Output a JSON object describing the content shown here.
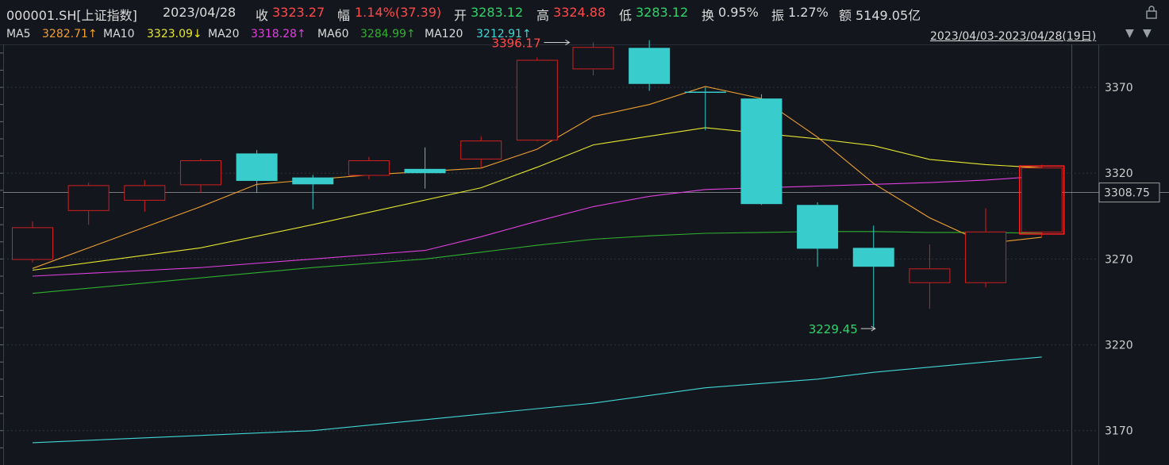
{
  "header": {
    "symbol": "000001.SH[上证指数]",
    "date": "2023/04/28",
    "close_label": "收",
    "close": "3323.27",
    "change_label": "幅",
    "change": "1.14%(37.39)",
    "open_label": "开",
    "open": "3283.12",
    "high_label": "高",
    "high": "3324.88",
    "low_label": "低",
    "low": "3283.12",
    "turnover_label": "换",
    "turnover": "0.95%",
    "amplitude_label": "振",
    "amplitude": "1.27%",
    "amount_label": "额",
    "amount": "5149.05亿"
  },
  "ma_bar": {
    "ma5_label": "MA5",
    "ma5": "3282.71↑",
    "ma10_label": "MA10",
    "ma10": "3323.09↓",
    "ma20_label": "MA20",
    "ma20": "3318.28↑",
    "ma60_label": "MA60",
    "ma60": "3284.99↑",
    "ma120_label": "MA120",
    "ma120": "3212.91↑",
    "range": "2023/04/03-2023/04/28(19日)",
    "dropdown_icon": "triangle-down-icon",
    "lock_icon": "lock-icon"
  },
  "colors": {
    "up": "#ff4a4a",
    "down": "#39cccc",
    "ma5": "#f0a030",
    "ma10": "#e8e830",
    "ma20": "#e040e0",
    "ma60": "#30b030",
    "ma120": "#40d8d8"
  },
  "chart_data": {
    "type": "candlestick",
    "ylim": [
      3150,
      3395
    ],
    "yticks": [
      3170,
      3220,
      3270,
      3320,
      3370
    ],
    "current_price_label": "3308.75",
    "current_price": 3308.75,
    "high_annotation": {
      "text": "3396.17",
      "value": 3396.17,
      "index": 10
    },
    "low_annotation": {
      "text": "3229.45",
      "value": 3229.45,
      "index": 15
    },
    "candles": [
      {
        "open": 3269.5,
        "close": 3288.5,
        "high": 3292.0,
        "low": 3268.0
      },
      {
        "open": 3298.0,
        "close": 3313.0,
        "high": 3314.5,
        "low": 3290.0
      },
      {
        "open": 3304.0,
        "close": 3313.0,
        "high": 3316.0,
        "low": 3297.5
      },
      {
        "open": 3313.0,
        "close": 3327.5,
        "high": 3328.5,
        "low": 3308.5
      },
      {
        "open": 3331.5,
        "close": 3315.5,
        "high": 3333.5,
        "low": 3308.5
      },
      {
        "open": 3317.5,
        "close": 3313.5,
        "high": 3319.0,
        "low": 3299.0
      },
      {
        "open": 3318.5,
        "close": 3327.5,
        "high": 3329.5,
        "low": 3316.5
      },
      {
        "open": 3322.5,
        "close": 3320.0,
        "high": 3335.0,
        "low": 3311.0
      },
      {
        "open": 3328.0,
        "close": 3339.0,
        "high": 3341.5,
        "low": 3323.0
      },
      {
        "open": 3339.0,
        "close": 3386.0,
        "high": 3387.5,
        "low": 3338.5
      },
      {
        "open": 3380.5,
        "close": 3393.5,
        "high": 3396.17,
        "low": 3377.0
      },
      {
        "open": 3393.0,
        "close": 3372.0,
        "high": 3397.5,
        "low": 3368.0
      },
      {
        "open": 3367.5,
        "close": 3367.0,
        "high": 3370.0,
        "low": 3345.0
      },
      {
        "open": 3363.5,
        "close": 3302.0,
        "high": 3366.0,
        "low": 3301.5
      },
      {
        "open": 3301.5,
        "close": 3276.0,
        "high": 3303.0,
        "low": 3265.5
      },
      {
        "open": 3276.5,
        "close": 3265.5,
        "high": 3289.5,
        "low": 3229.45
      },
      {
        "open": 3256.0,
        "close": 3264.5,
        "high": 3278.5,
        "low": 3241.0
      },
      {
        "open": 3256.0,
        "close": 3286.0,
        "high": 3299.5,
        "low": 3253.5
      },
      {
        "open": 3285.5,
        "close": 3323.27,
        "high": 3324.88,
        "low": 3283.12
      }
    ],
    "ma5": [
      3264.5,
      null,
      null,
      3300.5,
      3313.5,
      null,
      3319.0,
      null,
      3323.0,
      3334.0,
      3353.0,
      3360.0,
      3370.5,
      3363.5,
      3341.0,
      3314.0,
      3294.0,
      3279.0,
      3282.71
    ],
    "ma10": [
      3263.5,
      null,
      null,
      3276.5,
      null,
      3290.0,
      null,
      null,
      3311.5,
      3323.5,
      3336.5,
      3341.5,
      3346.5,
      null,
      3340.0,
      3336.0,
      3328.0,
      3325.0,
      3323.09
    ],
    "ma20": [
      3260.0,
      null,
      null,
      3265.0,
      null,
      3270.0,
      null,
      3275.0,
      3283.0,
      3292.0,
      3300.5,
      3306.5,
      3310.5,
      3311.5,
      3312.5,
      3313.5,
      3314.5,
      3316.0,
      3318.28
    ],
    "ma60": [
      3250.0,
      null,
      null,
      3259.0,
      null,
      3265.0,
      null,
      3270.0,
      3274.0,
      3278.0,
      3281.5,
      3283.5,
      3285.0,
      3285.5,
      3286.0,
      3286.0,
      3285.5,
      3285.5,
      3284.99
    ],
    "ma120": [
      3163.0,
      null,
      null,
      null,
      null,
      3170.0,
      null,
      null,
      null,
      null,
      3186.0,
      null,
      3195.0,
      null,
      3200.0,
      3204.0,
      3207.0,
      3210.0,
      3212.91
    ]
  }
}
